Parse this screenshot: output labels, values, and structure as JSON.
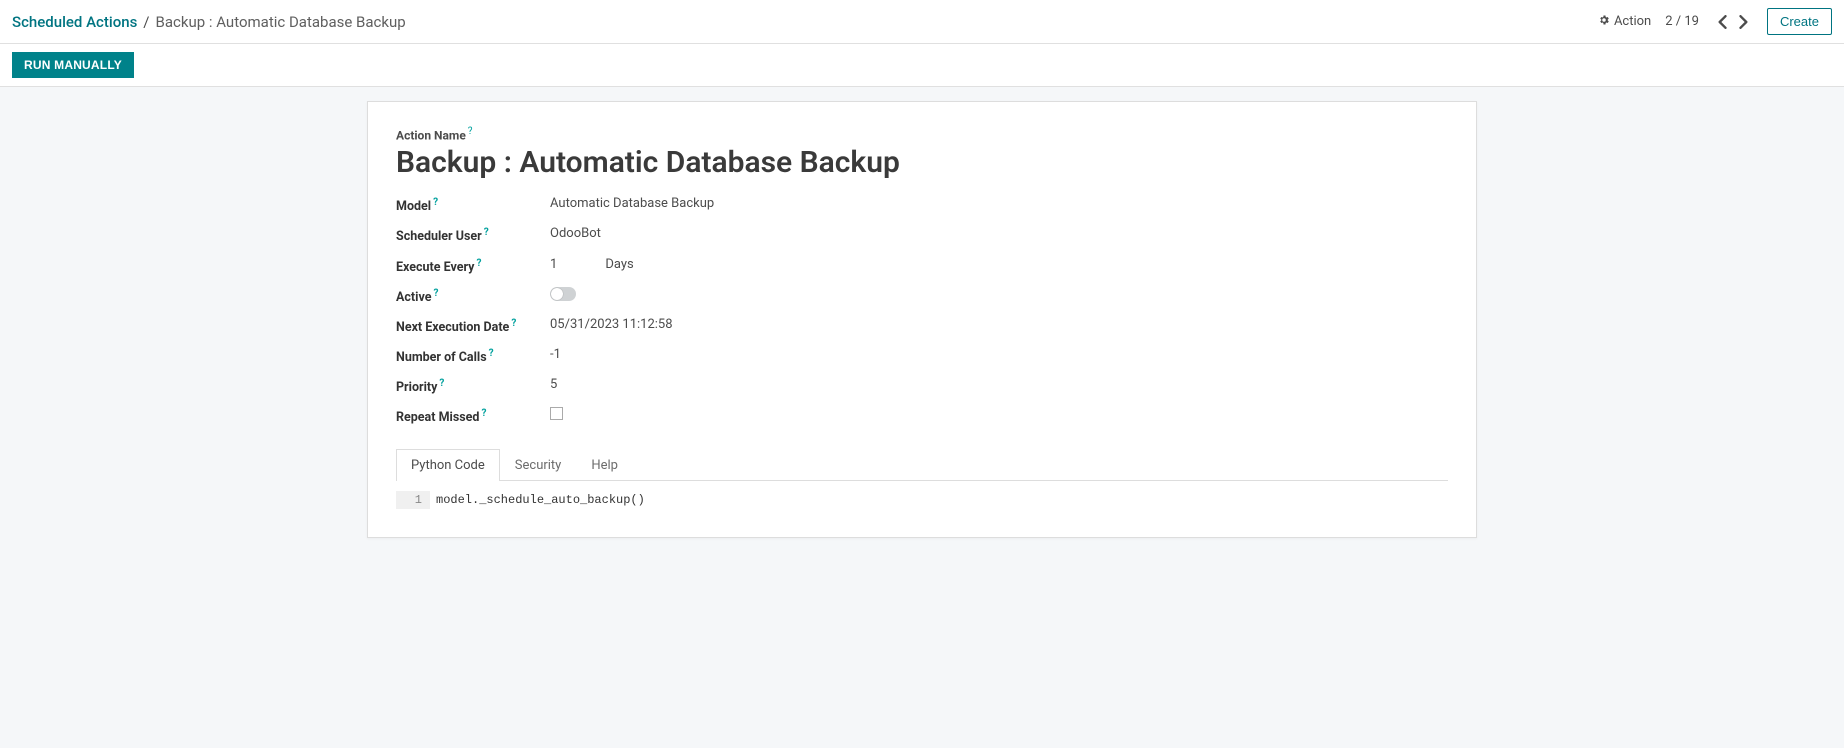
{
  "header": {
    "breadcrumb_root": "Scheduled Actions",
    "breadcrumb_sep": "/",
    "breadcrumb_current": "Backup : Automatic Database Backup",
    "action_label": "Action",
    "pager": "2 / 19",
    "create_label": "Create"
  },
  "statusbar": {
    "run_manually_label": "RUN MANUALLY"
  },
  "form": {
    "action_name_label": "Action Name",
    "action_name_value": "Backup : Automatic Database Backup",
    "model_label": "Model",
    "model_value": "Automatic Database Backup",
    "scheduler_user_label": "Scheduler User",
    "scheduler_user_value": "OdooBot",
    "execute_every_label": "Execute Every",
    "execute_every_number": "1",
    "execute_every_unit": "Days",
    "active_label": "Active",
    "active_value": false,
    "next_execution_label": "Next Execution Date",
    "next_execution_value": "05/31/2023 11:12:58",
    "number_of_calls_label": "Number of Calls",
    "number_of_calls_value": "-1",
    "priority_label": "Priority",
    "priority_value": "5",
    "repeat_missed_label": "Repeat Missed",
    "repeat_missed_value": false
  },
  "tabs": [
    {
      "label": "Python Code",
      "active": true
    },
    {
      "label": "Security",
      "active": false
    },
    {
      "label": "Help",
      "active": false
    }
  ],
  "code": {
    "line_number": "1",
    "line_content": "model._schedule_auto_backup()"
  },
  "help_marker": "?"
}
